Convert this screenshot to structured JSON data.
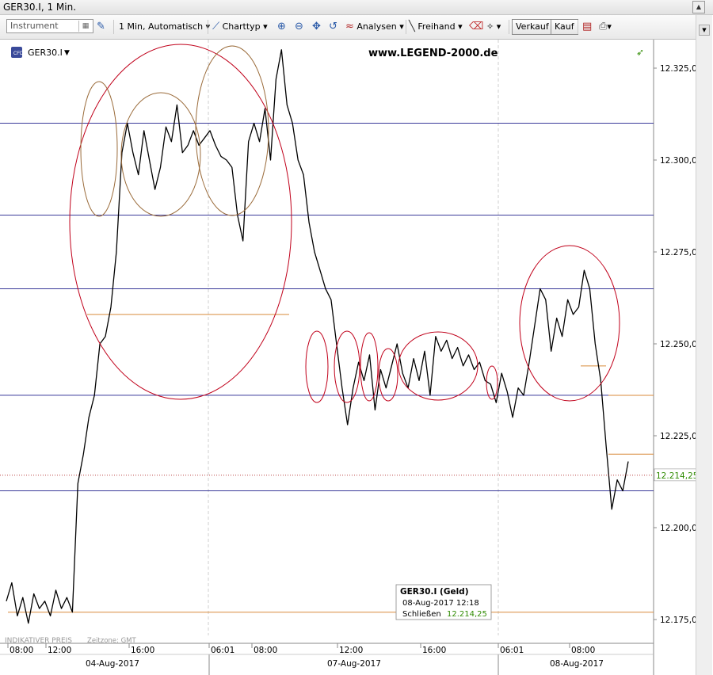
{
  "window": {
    "title": "GER30.I, 1 Min."
  },
  "toolbar": {
    "instrument_placeholder": "Instrument",
    "interval": "1 Min,",
    "scale_mode": "Automatisch",
    "charttype": "Charttyp",
    "analysen": "Analysen",
    "freihand": "Freihand",
    "verkauf": "Verkauf",
    "kauf": "Kauf"
  },
  "chart_header": {
    "symbol": "GER30.I",
    "watermark": "www.LEGEND-2000.de"
  },
  "y_axis": {
    "ticks": [
      "12.325,00",
      "12.300,00",
      "12.275,00",
      "12.250,00",
      "12.225,00",
      "12.200,00",
      "12.175,00"
    ]
  },
  "x_axis": {
    "time_ticks": [
      "08:00",
      "12:00",
      "16:00",
      "06:01",
      "08:00",
      "12:00",
      "16:00",
      "06:01",
      "08:00"
    ],
    "date_labels": [
      "04-Aug-2017",
      "07-Aug-2017",
      "08-Aug-2017"
    ]
  },
  "footer": {
    "price_type": "INDIKATIVER PREIS",
    "timezone": "Zeitzone: GMT"
  },
  "current_price": {
    "label": "12.214,25",
    "color": "#2e8b00"
  },
  "tooltip": {
    "title": "GER30.I (Geld)",
    "datetime": "08-Aug-2017 12:18",
    "close_label": "Schließen",
    "close_value": "12.214,25"
  },
  "colors": {
    "price_line": "#000000",
    "support_lines": "#1f1f8c",
    "orange_lines": "#d88a3a",
    "circles_red": "#c0001a",
    "circles_brown": "#9a6b3a"
  },
  "chart_data": {
    "type": "line",
    "ylim": [
      12165,
      12335
    ],
    "y_ticks": [
      12325,
      12300,
      12275,
      12250,
      12225,
      12200,
      12175
    ],
    "x_ticks": [
      "08:00",
      "12:00",
      "16:00",
      "06:01",
      "08:00",
      "12:00",
      "16:00",
      "06:01",
      "08:00"
    ],
    "series": [
      {
        "values": [
          12180,
          12185,
          12176,
          12181,
          12174,
          12182,
          12178,
          12180,
          12176,
          12183,
          12178,
          12181,
          12177,
          12212,
          12220,
          12230,
          12236,
          12250,
          12252,
          12260,
          12275,
          12302,
          12310,
          12302,
          12296,
          12308,
          12300,
          12292,
          12298,
          12309,
          12305,
          12315,
          12302,
          12304,
          12308,
          12304,
          12306,
          12308,
          12304,
          12301,
          12300,
          12298,
          12285,
          12278,
          12305,
          12310,
          12305,
          12314,
          12300,
          12322,
          12330,
          12315,
          12310,
          12300,
          12296,
          12283,
          12275,
          12270,
          12265,
          12262,
          12250,
          12238,
          12228,
          12238,
          12245,
          12240,
          12247,
          12232,
          12243,
          12238,
          12244,
          12250,
          12242,
          12238,
          12246,
          12240,
          12248,
          12236,
          12252,
          12248,
          12251,
          12246,
          12249,
          12244,
          12247,
          12243,
          12245,
          12240,
          12239,
          12234,
          12242,
          12237,
          12230,
          12238,
          12236,
          12245,
          12255,
          12265,
          12262,
          12248,
          12257,
          12252,
          12262,
          12258,
          12260,
          12270,
          12265,
          12250,
          12240,
          12222,
          12205,
          12213,
          12210,
          12218
        ]
      }
    ],
    "horizontal_levels": {
      "blue": [
        12310,
        12285,
        12265,
        12236,
        12210
      ],
      "orange": [
        12258,
        12244,
        12236,
        12220,
        12177
      ]
    },
    "current_price_level": 12214.25
  }
}
